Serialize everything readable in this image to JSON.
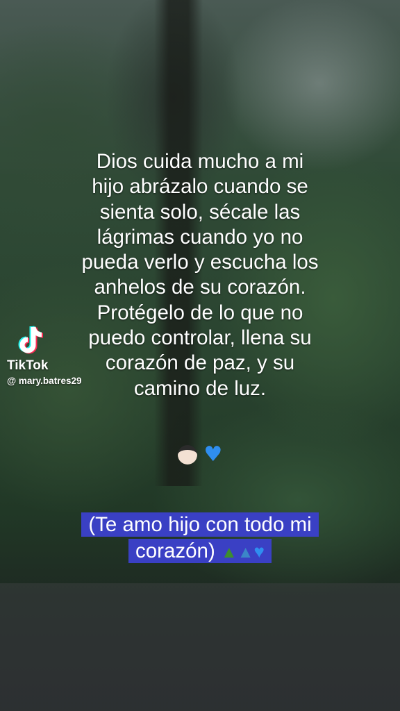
{
  "main_text_lines": [
    "Dios cuida mucho a mi",
    "hijo abrázalo cuando se",
    "sienta solo, sécale las",
    "lágrimas cuando yo no",
    "pueda verlo y escucha los",
    "anhelos de su corazón.",
    "Protégelo de lo que no",
    "puedo controlar, llena su",
    "corazón de paz, y su",
    "camino de luz."
  ],
  "emoji_row": [
    "boy-emoji",
    "blue-heart-emoji"
  ],
  "caption": {
    "line1": "(Te amo hijo con todo mi",
    "line2": "corazón)",
    "emojis": [
      "t-rex-emoji",
      "sauropod-emoji",
      "blue-heart-emoji"
    ]
  },
  "watermark": {
    "brand": "TikTok",
    "handle": "@ mary.batres29"
  },
  "colors": {
    "caption_highlight": "#3a40c4",
    "heart": "#2f8ef0",
    "text": "#ffffff"
  }
}
